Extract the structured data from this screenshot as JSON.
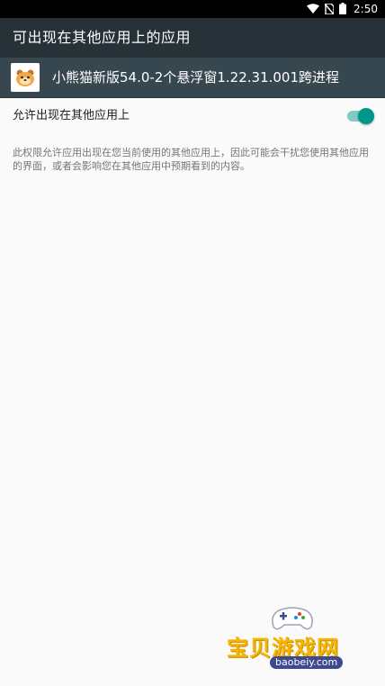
{
  "status_bar": {
    "time": "2:50",
    "icons": [
      "wifi-icon",
      "no-sim-icon",
      "battery-icon"
    ]
  },
  "app_bar": {
    "title": "可出现在其他应用上的应用"
  },
  "app_header": {
    "icon": "bear-cat-app-icon",
    "name": "小熊猫新版54.0-2个悬浮窗1.22.31.001跨进程"
  },
  "permission": {
    "label": "允许出现在其他应用上",
    "enabled": true,
    "description": "此权限允许应用出现在您当前使用的其他应用上，因此可能会干扰您使用其他应用的界面，或者会影响您在其他应用中预期看到的内容。"
  },
  "watermark": {
    "text": "宝贝游戏网",
    "url": "baobeiy.com"
  },
  "colors": {
    "app_bar": "#263238",
    "app_header": "#37474f",
    "accent": "#009688",
    "background": "#fafafa"
  }
}
